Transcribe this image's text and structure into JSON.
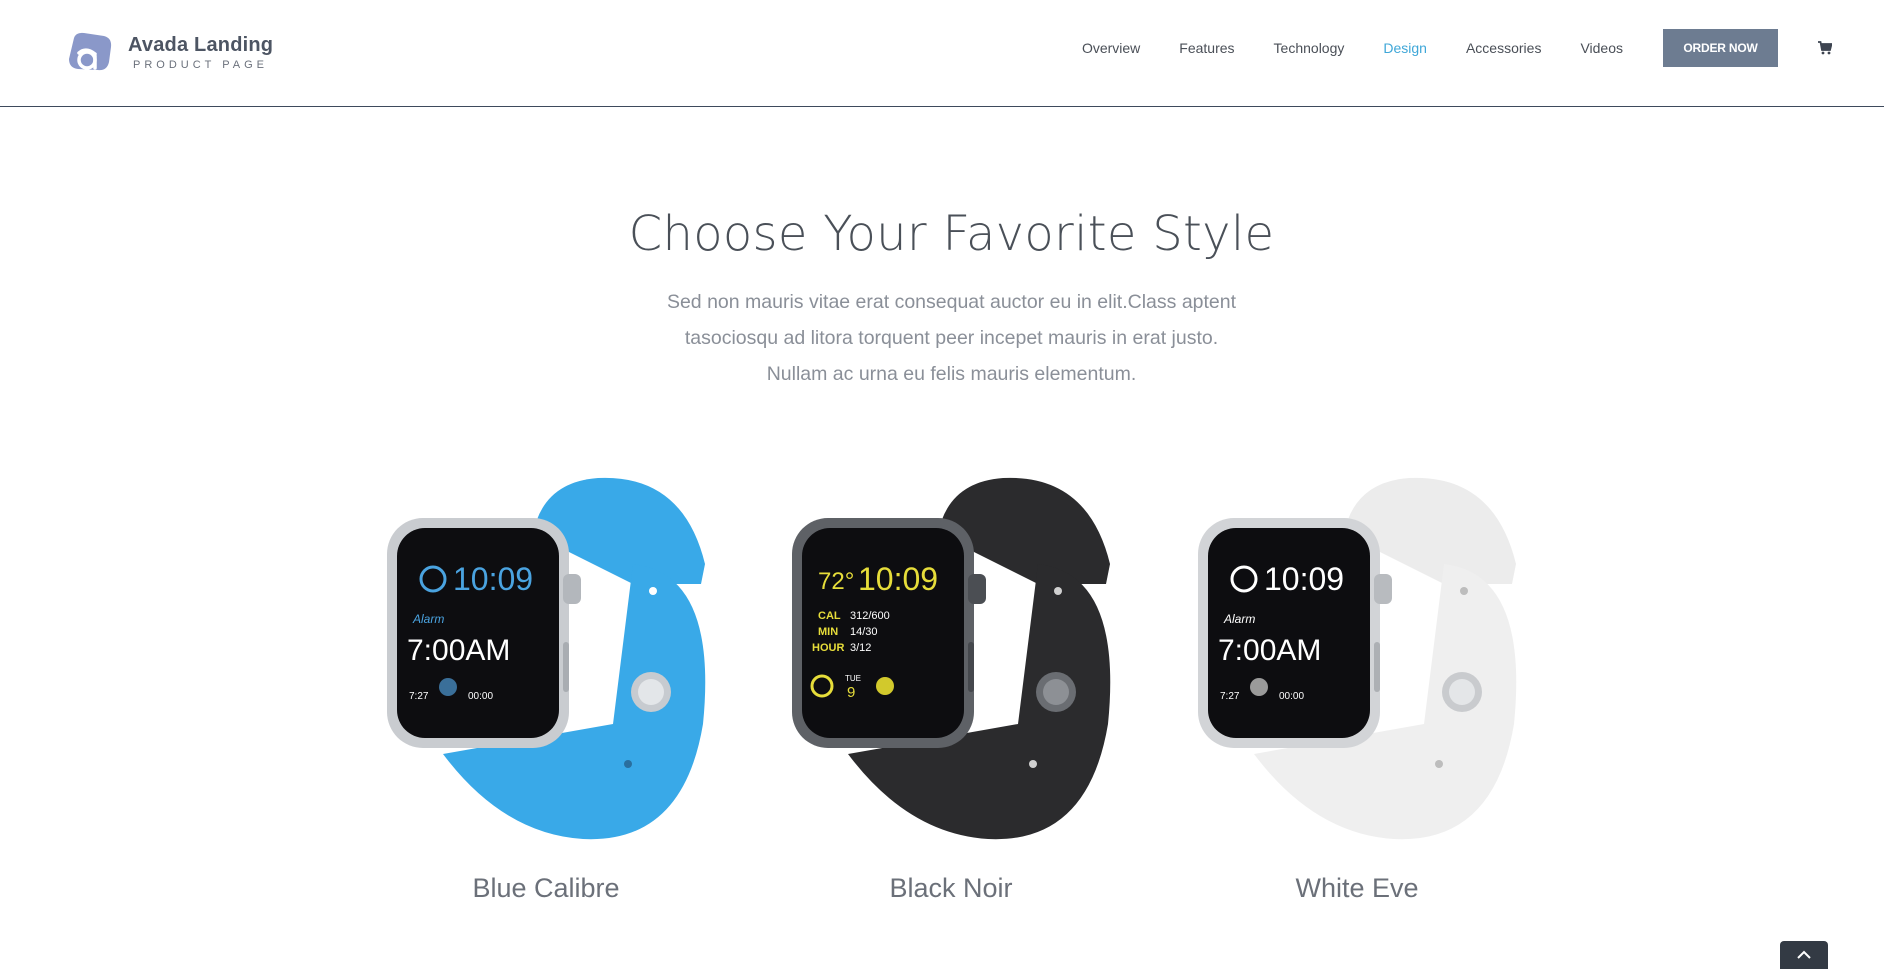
{
  "header": {
    "logo_title": "Avada Landing",
    "logo_subtitle": "PRODUCT PAGE",
    "nav": [
      {
        "label": "Overview",
        "active": false
      },
      {
        "label": "Features",
        "active": false
      },
      {
        "label": "Technology",
        "active": false
      },
      {
        "label": "Design",
        "active": true
      },
      {
        "label": "Accessories",
        "active": false
      },
      {
        "label": "Videos",
        "active": false
      }
    ],
    "order_button": "ORDER NOW",
    "cart_icon": "shopping-cart-icon"
  },
  "section": {
    "title": "Choose Your Favorite Style",
    "description": "Sed non mauris vitae erat consequat auctor eu in elit.Class aptent tasociosqu ad litora torquent peer incepet mauris in erat justo. Nullam ac urna eu felis mauris elementum."
  },
  "products": [
    {
      "name": "Blue Calibre",
      "band_color": "#39a9e8",
      "case_color": "#c9ccd0",
      "face_color": "#4aa3e0",
      "screen": {
        "time": "10:09",
        "label": "Alarm",
        "big": "7:00AM",
        "small_left": "7:27",
        "small_right": "00:00"
      }
    },
    {
      "name": "Black Noir",
      "band_color": "#2b2b2d",
      "case_color": "#5e6166",
      "face_color": "#e6dd3a",
      "screen": {
        "temp": "72°",
        "time": "10:09",
        "cal": "CAL",
        "cal_val": "312/600",
        "min": "MIN",
        "min_val": "14/30",
        "hour": "HOUR",
        "hour_val": "3/12",
        "day": "TUE",
        "date": "9"
      }
    },
    {
      "name": "White Eve",
      "band_color": "#f1f1f1",
      "case_color": "#d2d4d7",
      "face_color": "#ffffff",
      "screen": {
        "time": "10:09",
        "label": "Alarm",
        "big": "7:00AM",
        "small_left": "7:27",
        "small_right": "00:00"
      }
    }
  ],
  "scroll_top_icon": "chevron-up-icon"
}
